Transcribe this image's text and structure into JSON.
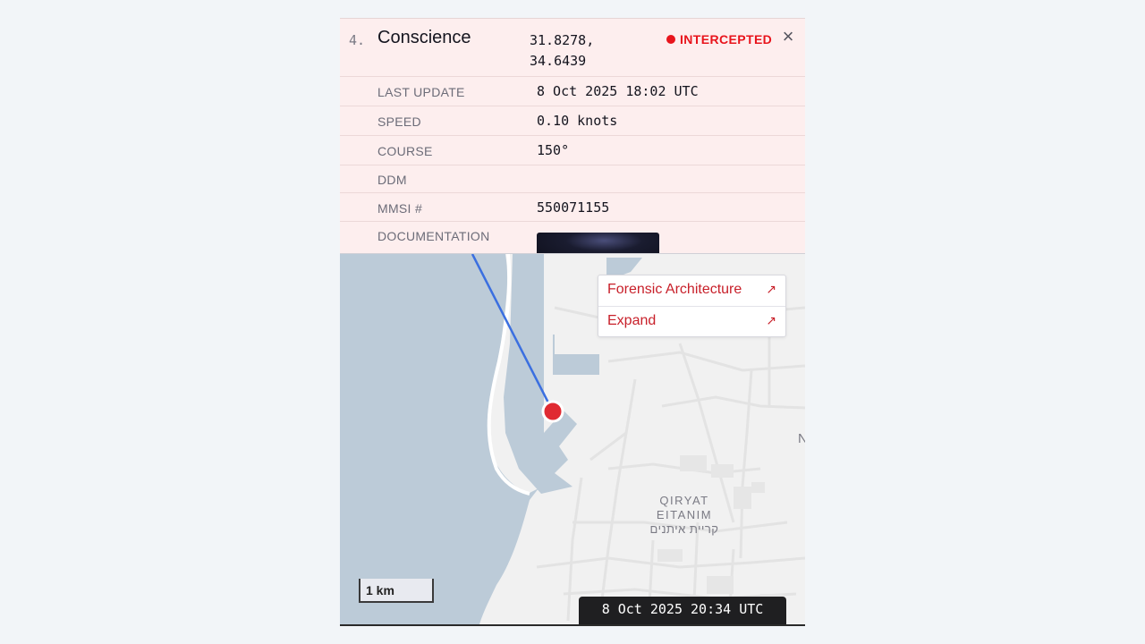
{
  "colors": {
    "status": "#e8141c",
    "accent_link": "#c8202a",
    "track_line": "#3b6fe0",
    "vessel_marker": "#e02a32",
    "water": "#bccbd8",
    "land": "#f1f1f1",
    "roads": "#e2e2e2"
  },
  "vessel": {
    "index": "4.",
    "name": "Conscience",
    "lat": "31.8278,",
    "lon": "34.6439",
    "status_label": "INTERCEPTED",
    "close_icon": "close-icon"
  },
  "details": [
    {
      "label": "LAST UPDATE",
      "value": "8 Oct 2025 18:02 UTC"
    },
    {
      "label": "SPEED",
      "value": "0.10 knots"
    },
    {
      "label": "COURSE",
      "value": "150°"
    },
    {
      "label": "DDM",
      "value": ""
    },
    {
      "label": "MMSI #",
      "value": "550071155"
    },
    {
      "label": "DOCUMENTATION",
      "value": ""
    }
  ],
  "documentation": {
    "thumbnail_icon": "photo-thumbnail"
  },
  "map": {
    "links": [
      {
        "label": "Forensic Architecture",
        "icon": "arrow-up-right-icon"
      },
      {
        "label": "Expand",
        "icon": "arrow-up-right-icon"
      }
    ],
    "place_label": {
      "line1": "QIRYAT",
      "line2": "EITANIM",
      "line3": "קריית איתנים"
    },
    "edge_label": "N",
    "scale": "1 km",
    "timestamp": "8 Oct 2025 20:34 UTC"
  }
}
